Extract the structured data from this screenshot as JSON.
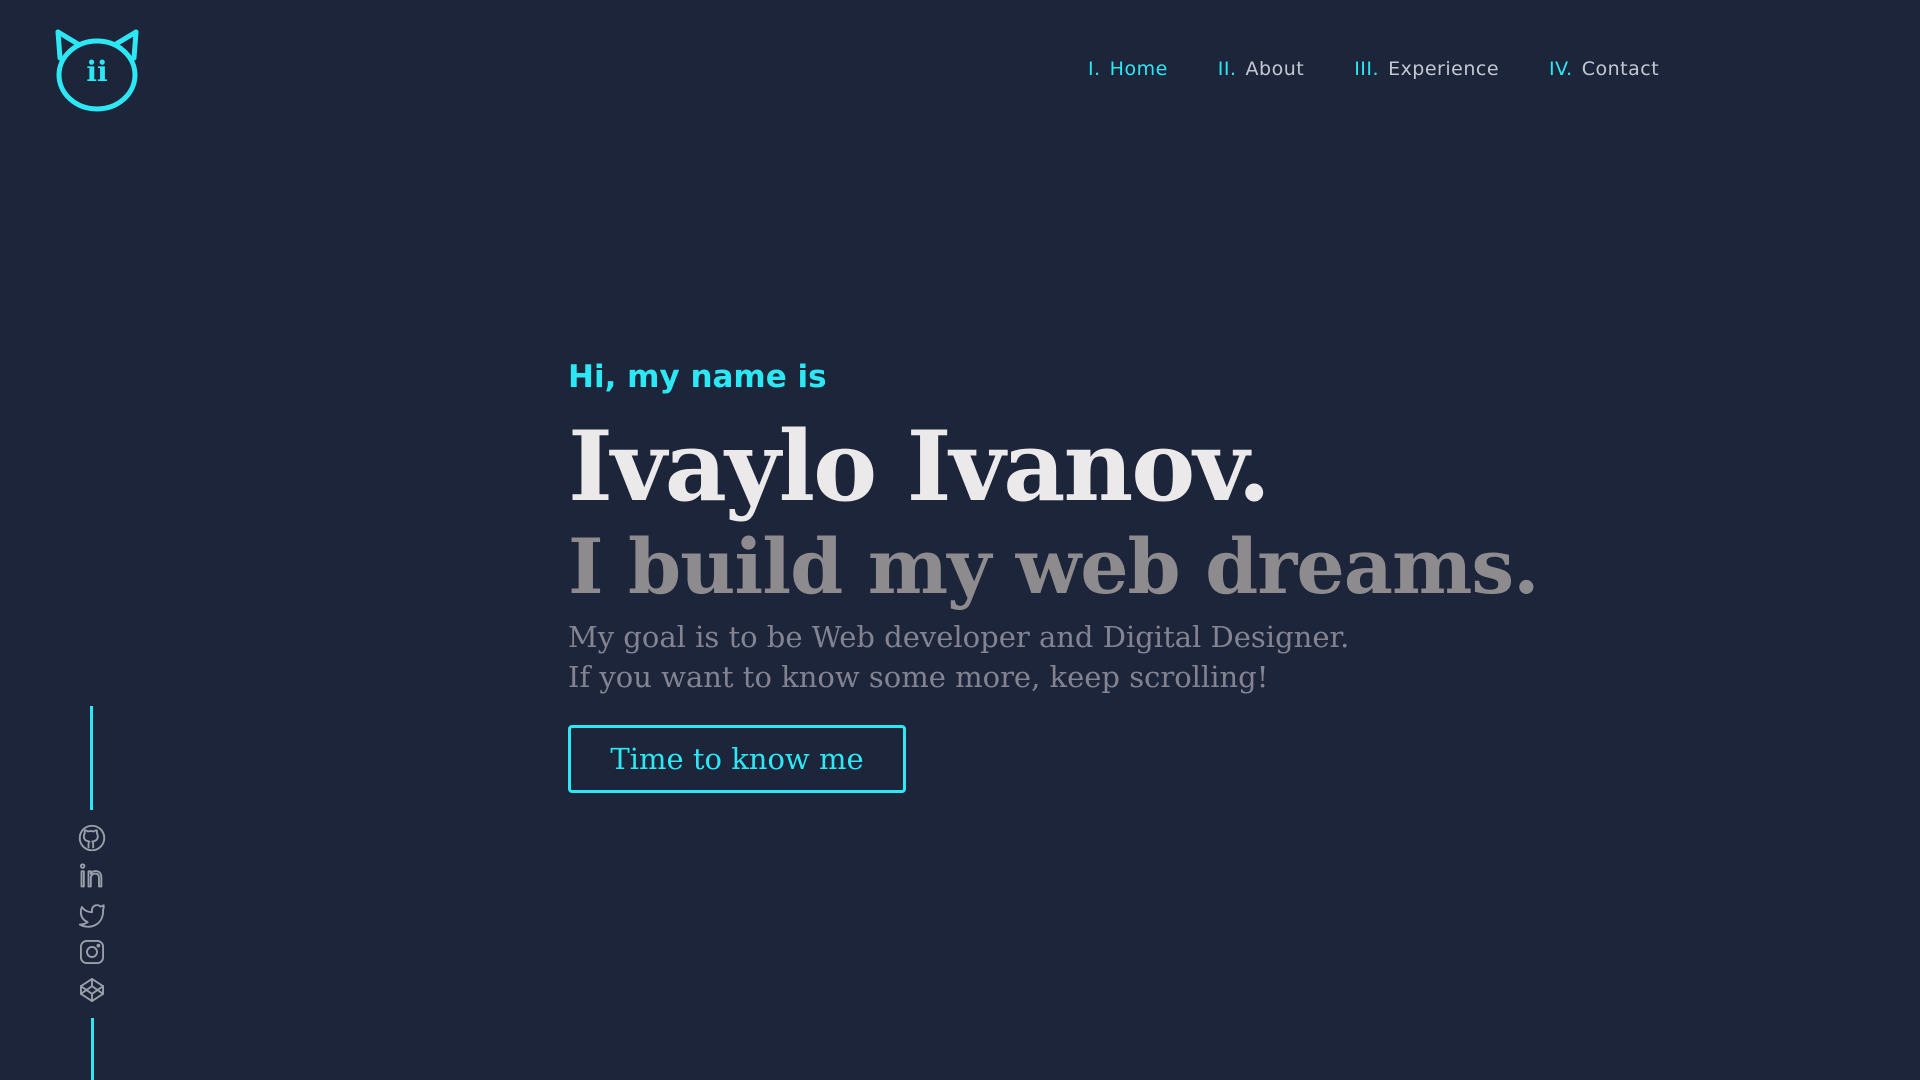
{
  "logo": {
    "text": "ii",
    "icon": "cat-head-logo"
  },
  "nav": {
    "items": [
      {
        "num": "I.",
        "label": "Home"
      },
      {
        "num": "II.",
        "label": "About"
      },
      {
        "num": "III.",
        "label": "Experience"
      },
      {
        "num": "IV.",
        "label": "Contact"
      }
    ],
    "active": "Home"
  },
  "hero": {
    "greeting": "Hi, my name is",
    "name": "Ivaylo Ivanov.",
    "tagline": "I build my web dreams.",
    "desc_line1": "My goal is to be Web developer and Digital Designer.",
    "desc_line2": "If you want to know some more, keep scrolling!",
    "cta": "Time to know me"
  },
  "socials": [
    "github-icon",
    "linkedin-icon",
    "twitter-icon",
    "instagram-icon",
    "codepen-icon"
  ],
  "colors": {
    "background": "#1c2539",
    "accent": "#2ce8f5",
    "name": "#ebe9ea",
    "tagline": "#8e8b8f",
    "desc": "#838391",
    "nav_text": "#c3c8d2",
    "icon": "#9aa0ab"
  }
}
